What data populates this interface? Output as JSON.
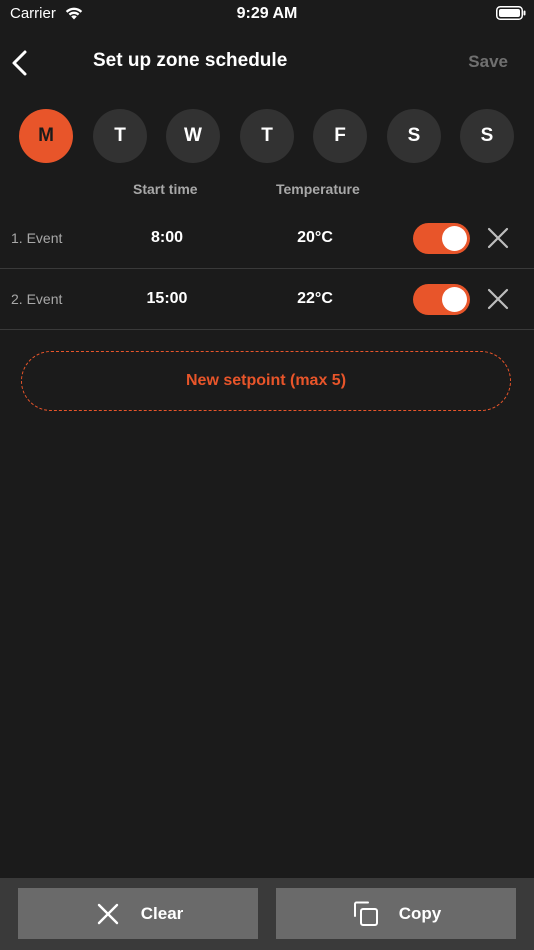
{
  "status_bar": {
    "carrier": "Carrier",
    "time": "9:29 AM"
  },
  "nav": {
    "title": "Set up zone schedule",
    "save_label": "Save"
  },
  "days": [
    {
      "label": "M",
      "active": true
    },
    {
      "label": "T",
      "active": false
    },
    {
      "label": "W",
      "active": false
    },
    {
      "label": "T",
      "active": false
    },
    {
      "label": "F",
      "active": false
    },
    {
      "label": "S",
      "active": false
    },
    {
      "label": "S",
      "active": false
    }
  ],
  "columns": {
    "start_time": "Start time",
    "temperature": "Temperature"
  },
  "events": [
    {
      "label": "1. Event",
      "time": "8:00",
      "temperature": "20°C",
      "enabled": true
    },
    {
      "label": "2. Event",
      "time": "15:00",
      "temperature": "22°C",
      "enabled": true
    }
  ],
  "new_setpoint_label": "New setpoint (max 5)",
  "bottom": {
    "clear_label": "Clear",
    "copy_label": "Copy"
  },
  "colors": {
    "accent": "#e8552a",
    "background": "#1b1b1b",
    "day_inactive": "#323232",
    "button": "#6a6a6a"
  },
  "icons": [
    "wifi-icon",
    "battery-icon",
    "back-chevron-icon",
    "close-icon",
    "copy-icon"
  ]
}
